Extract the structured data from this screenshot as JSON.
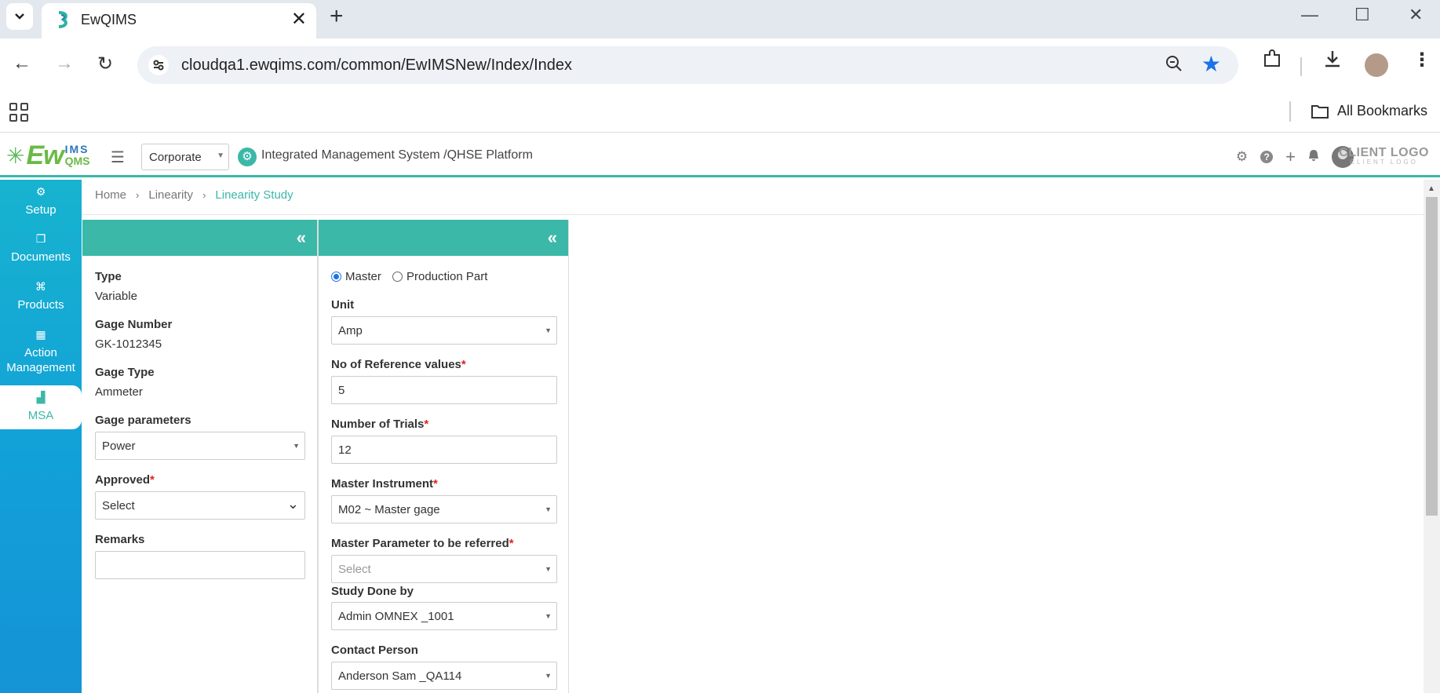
{
  "browser": {
    "tab_title": "EwQIMS",
    "url": "cloudqa1.ewqims.com/common/EwIMSNew/Index/Index",
    "all_bookmarks": "All Bookmarks"
  },
  "header": {
    "logo_main": "Ew",
    "logo_ims": "IMS",
    "logo_qms": "QMS",
    "corporate": "Corporate",
    "platform_title": "Integrated Management System /QHSE Platform",
    "client_logo": "CLIENT LOGO",
    "client_logo_sub": "CLIENT LOGO"
  },
  "sidebar": {
    "items": [
      {
        "label": "Setup",
        "icon": "gears-icon"
      },
      {
        "label": "Documents",
        "icon": "documents-icon"
      },
      {
        "label": "Products",
        "icon": "products-icon"
      },
      {
        "label": "Action Management",
        "icon": "building-icon"
      },
      {
        "label": "MSA",
        "icon": "chart-icon"
      }
    ]
  },
  "breadcrumb": {
    "home": "Home",
    "linearity": "Linearity",
    "current": "Linearity Study"
  },
  "left_panel": {
    "type_label": "Type",
    "type_value": "Variable",
    "gage_number_label": "Gage Number",
    "gage_number_value": "GK-1012345",
    "gage_type_label": "Gage Type",
    "gage_type_value": "Ammeter",
    "gage_params_label": "Gage parameters",
    "gage_params_value": "Power",
    "approved_label": "Approved",
    "approved_value": "Select",
    "remarks_label": "Remarks",
    "remarks_value": ""
  },
  "right_panel": {
    "radio_master": "Master",
    "radio_production": "Production Part",
    "unit_label": "Unit",
    "unit_value": "Amp",
    "ref_values_label": "No of Reference values",
    "ref_values_value": "5",
    "trials_label": "Number of Trials",
    "trials_value": "12",
    "master_instrument_label": "Master Instrument",
    "master_instrument_value": "M02 ~ Master gage",
    "master_param_label": "Master Parameter to be referred",
    "master_param_placeholder": "Select",
    "study_done_label": "Study Done by",
    "study_done_value": "Admin OMNEX _1001",
    "contact_label": "Contact Person",
    "contact_value": "Anderson Sam _QA114"
  },
  "required_mark": "*"
}
